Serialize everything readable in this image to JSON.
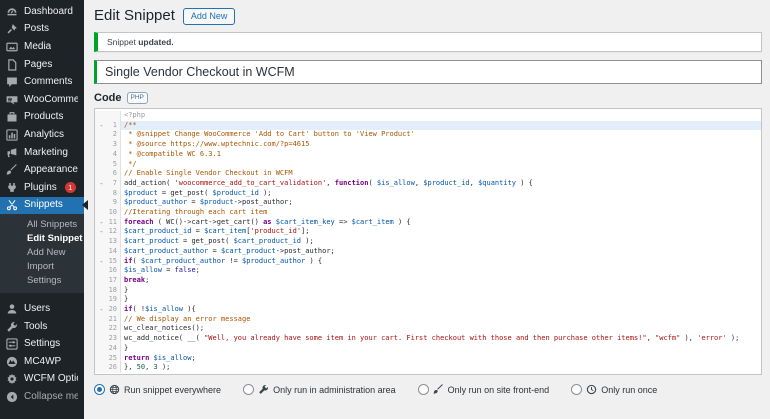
{
  "colors": {
    "accent": "#2271b1",
    "success_green": "#00a32a",
    "badge_red": "#d63638",
    "sidebar_bg": "#1d2327",
    "submenu_bg": "#2c3338",
    "page_bg": "#f0f0f1",
    "active_line_bg": "#e2effa"
  },
  "header": {
    "title": "Edit Snippet",
    "add_new_label": "Add New"
  },
  "notice": {
    "text_prefix": "Snippet ",
    "text_bold": "updated."
  },
  "snippet": {
    "title": "Single Vendor Checkout in WCFM"
  },
  "code_section": {
    "label": "Code",
    "badge": "PHP",
    "php_open": "<?php"
  },
  "sidebar": {
    "items": [
      {
        "id": "dashboard",
        "label": "Dashboard",
        "icon": "dashboard"
      },
      {
        "id": "posts",
        "label": "Posts",
        "icon": "pin"
      },
      {
        "id": "media",
        "label": "Media",
        "icon": "media"
      },
      {
        "id": "pages",
        "label": "Pages",
        "icon": "pages"
      },
      {
        "id": "comments",
        "label": "Comments",
        "icon": "comments"
      },
      {
        "id": "woocommerce",
        "label": "WooCommerce",
        "icon": "woocommerce"
      },
      {
        "id": "products",
        "label": "Products",
        "icon": "products"
      },
      {
        "id": "analytics",
        "label": "Analytics",
        "icon": "analytics"
      },
      {
        "id": "marketing",
        "label": "Marketing",
        "icon": "marketing"
      },
      {
        "id": "appearance",
        "label": "Appearance",
        "icon": "brush"
      },
      {
        "id": "plugins",
        "label": "Plugins",
        "icon": "plugins",
        "badge": "1"
      },
      {
        "id": "snippets",
        "label": "Snippets",
        "icon": "scissors",
        "active": true,
        "submenu": [
          {
            "label": "All Snippets"
          },
          {
            "label": "Edit Snippet",
            "current": true
          },
          {
            "label": "Add New"
          },
          {
            "label": "Import"
          },
          {
            "label": "Settings"
          }
        ]
      },
      {
        "id": "users",
        "label": "Users",
        "icon": "users"
      },
      {
        "id": "tools",
        "label": "Tools",
        "icon": "wrench"
      },
      {
        "id": "settings",
        "label": "Settings",
        "icon": "sliders"
      },
      {
        "id": "mc4wp",
        "label": "MC4WP",
        "icon": "mc4wp"
      },
      {
        "id": "wcfm-options",
        "label": "WCFM Options",
        "icon": "gear"
      },
      {
        "id": "collapse-menu",
        "label": "Collapse menu",
        "icon": "collapse",
        "dim": true
      }
    ]
  },
  "editor": {
    "active_line": 1,
    "fold_lines": [
      1,
      7,
      11,
      12,
      15,
      20
    ],
    "lines": [
      "/**",
      " * @snippet Change WooCommerce 'Add to Cart' button to 'View Product'",
      " * @source https://www.wptechnic.com/?p=4615",
      " * @compatible WC 6.3.1",
      " */",
      "// Enable Single Vendor Checkout in WCFM",
      "add_action( 'woocommerce_add_to_cart_validation', function( $is_allow, $product_id, $quantity ) {",
      "$product = get_post( $product_id );",
      "$product_author = $product->post_author;",
      "//Iterating through each cart item",
      "foreach ( WC()->cart->get_cart() as $cart_item_key => $cart_item ) {",
      "$cart_product_id = $cart_item['product_id'];",
      "$cart_product = get_post( $cart_product_id );",
      "$cart_product_author = $cart_product->post_author;",
      "if( $cart_product_author != $product_author ) {",
      "$is_allow = false;",
      "break;",
      "}",
      "}",
      "if( !$is_allow ){",
      "// We display an error message",
      "wc_clear_notices();",
      "wc_add_notice( __( \"Well, you already have some item in your cart. First checkout with those and then purchase other items!\", \"wcfm\" ), 'error' );",
      "}",
      "return $is_allow;",
      "}, 50, 3 );"
    ]
  },
  "scope_options": [
    {
      "icon": "globe",
      "label": "Run snippet everywhere",
      "selected": true
    },
    {
      "icon": "wrench",
      "label": "Only run in administration area",
      "selected": false
    },
    {
      "icon": "brush",
      "label": "Only run on site front-end",
      "selected": false
    },
    {
      "icon": "clock",
      "label": "Only run once",
      "selected": false
    }
  ]
}
